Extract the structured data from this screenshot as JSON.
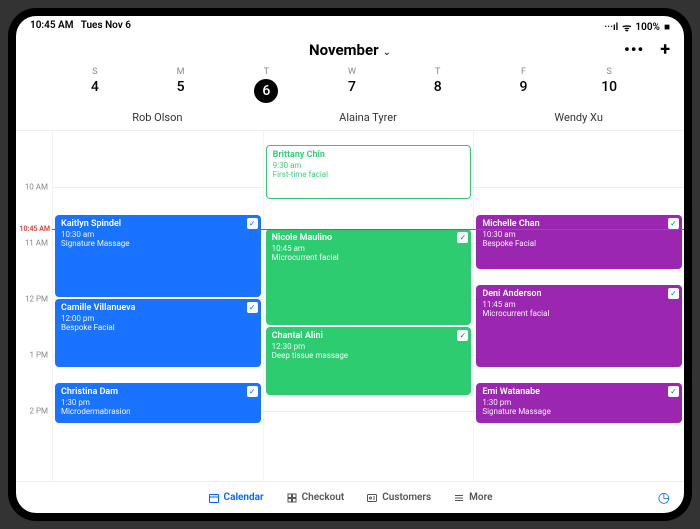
{
  "status": {
    "time": "10:45 AM",
    "date": "Tues Nov 6",
    "signal": "···ıl",
    "wifi": "ᯤ",
    "battery": "100%",
    "batt_icon": "■"
  },
  "header": {
    "month": "November",
    "menu_icon": "•••",
    "add_icon": "+"
  },
  "week": [
    {
      "letter": "S",
      "num": "4",
      "selected": false
    },
    {
      "letter": "M",
      "num": "5",
      "selected": false
    },
    {
      "letter": "T",
      "num": "6",
      "selected": true
    },
    {
      "letter": "W",
      "num": "7",
      "selected": false
    },
    {
      "letter": "T",
      "num": "8",
      "selected": false
    },
    {
      "letter": "F",
      "num": "9",
      "selected": false
    },
    {
      "letter": "S",
      "num": "10",
      "selected": false
    }
  ],
  "columns": [
    "Rob Olson",
    "Alaina Tyrer",
    "Wendy Xu"
  ],
  "time_labels": [
    {
      "text": "10 AM",
      "h": 10
    },
    {
      "text": "11 AM",
      "h": 11
    },
    {
      "text": "12 PM",
      "h": 12
    },
    {
      "text": "1 PM",
      "h": 13
    },
    {
      "text": "2 PM",
      "h": 14
    }
  ],
  "now": {
    "label": "10:45 AM",
    "h": 10.75
  },
  "grid": {
    "start": 9,
    "pxPerHour": 56
  },
  "colors": {
    "blue": "#1a73ff",
    "green": "#2ecc71",
    "purple": "#9b27b0"
  },
  "appointments": [
    {
      "col": 1,
      "name": "Brittany Chin",
      "time": "9:30 am",
      "service": "First-time facial",
      "start": 9.25,
      "dur": 1.0,
      "style": "outline",
      "check": false
    },
    {
      "col": 0,
      "name": "Kaitlyn Spindel",
      "time": "10:30 am",
      "service": "Signature Massage",
      "start": 10.5,
      "dur": 1.5,
      "color": "blue",
      "check": true
    },
    {
      "col": 1,
      "name": "Nicole Maulino",
      "time": "10:45 am",
      "service": "Microcurrent facial",
      "start": 10.75,
      "dur": 1.75,
      "color": "green",
      "check": true
    },
    {
      "col": 2,
      "name": "Michelle Chan",
      "time": "10:30 am",
      "service": "Bespoke Facial",
      "start": 10.5,
      "dur": 1.0,
      "color": "purple",
      "check": true
    },
    {
      "col": 0,
      "name": "Camille Villanueva",
      "time": "12:00 pm",
      "service": "Bespoke Facial",
      "start": 12.0,
      "dur": 1.25,
      "color": "blue",
      "check": true
    },
    {
      "col": 1,
      "name": "Chantal Alini",
      "time": "12:30 pm",
      "service": "Deep tissue massage",
      "start": 12.5,
      "dur": 1.25,
      "color": "green",
      "check": true
    },
    {
      "col": 2,
      "name": "Deni Anderson",
      "time": "11:45 am",
      "service": "Microcurrent facial",
      "start": 11.75,
      "dur": 1.5,
      "color": "purple",
      "check": true
    },
    {
      "col": 0,
      "name": "Christina Dam",
      "time": "1:30 pm",
      "service": "Microdermabrasion",
      "start": 13.5,
      "dur": 0.75,
      "color": "blue",
      "check": true
    },
    {
      "col": 2,
      "name": "Emi Watanabe",
      "time": "1:30 pm",
      "service": "Signature Massage",
      "start": 13.5,
      "dur": 0.75,
      "color": "purple",
      "check": true
    }
  ],
  "nav": {
    "items": [
      {
        "label": "Calendar",
        "active": true
      },
      {
        "label": "Checkout",
        "active": false
      },
      {
        "label": "Customers",
        "active": false
      },
      {
        "label": "More",
        "active": false
      }
    ],
    "clock": "◷"
  }
}
